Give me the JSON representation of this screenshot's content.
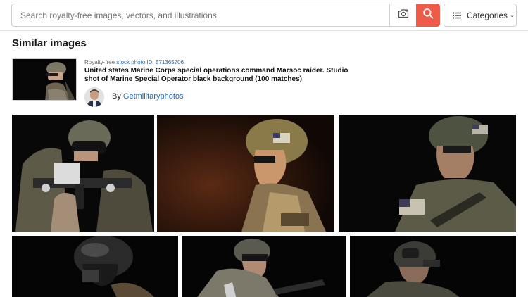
{
  "search": {
    "placeholder": "Search royalty-free images, vectors, and illustrations",
    "value": ""
  },
  "categories": {
    "label": "Categories"
  },
  "icons": {
    "camera": "camera-search-icon",
    "search": "magnifier-icon",
    "categories": "list-icon",
    "chevron": "chevron-down-icon"
  },
  "colors": {
    "accent": "#ef5b49",
    "link": "#2e6aa8"
  },
  "section": {
    "title": "Similar images"
  },
  "reference": {
    "meta_prefix": "Royalty-free",
    "meta_link": "stock photo ID: 571365706",
    "title": "United states Marine Corps special operations command Marsoc raider. Studio shot of Marine Special Operator black background (100 matches)",
    "by_prefix": "By",
    "author": "Getmilitaryphotos"
  },
  "results": [
    {
      "alt": "soldier aiming submachine gun"
    },
    {
      "alt": "soldier helmet profile warm light"
    },
    {
      "alt": "soldier helmet with flag patch"
    },
    {
      "alt": "soldier in black helmet"
    },
    {
      "alt": "soldier with goggles and rifle"
    },
    {
      "alt": "soldier with night vision goggles"
    }
  ]
}
